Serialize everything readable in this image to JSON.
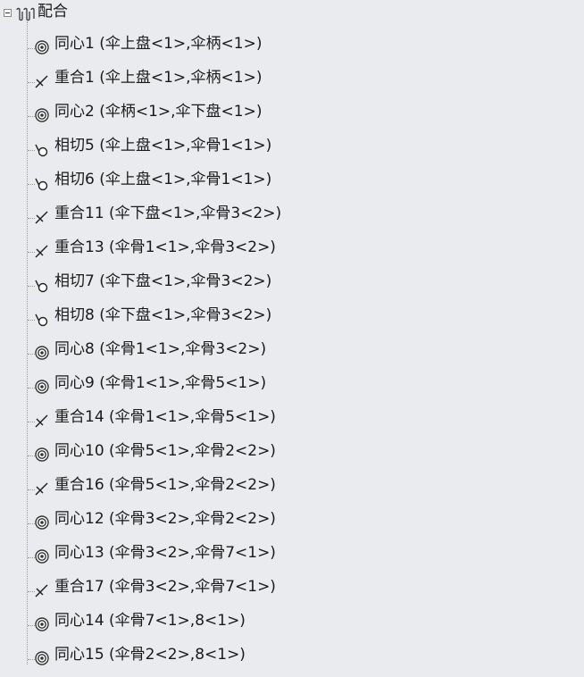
{
  "tree": {
    "root": {
      "label": "配合",
      "icon": "mate-folder-icon",
      "expanded": true
    },
    "items": [
      {
        "label": "同心1 (伞上盘<1>,伞柄<1>)",
        "icon": "concentric-mate-icon"
      },
      {
        "label": "重合1 (伞上盘<1>,伞柄<1>)",
        "icon": "coincident-mate-icon"
      },
      {
        "label": "同心2 (伞柄<1>,伞下盘<1>)",
        "icon": "concentric-mate-icon"
      },
      {
        "label": "相切5 (伞上盘<1>,伞骨1<1>)",
        "icon": "tangent-mate-icon"
      },
      {
        "label": "相切6 (伞上盘<1>,伞骨1<1>)",
        "icon": "tangent-mate-icon"
      },
      {
        "label": "重合11 (伞下盘<1>,伞骨3<2>)",
        "icon": "coincident-mate-icon"
      },
      {
        "label": "重合13 (伞骨1<1>,伞骨3<2>)",
        "icon": "coincident-mate-icon"
      },
      {
        "label": "相切7 (伞下盘<1>,伞骨3<2>)",
        "icon": "tangent-mate-icon"
      },
      {
        "label": "相切8 (伞下盘<1>,伞骨3<2>)",
        "icon": "tangent-mate-icon"
      },
      {
        "label": "同心8 (伞骨1<1>,伞骨3<2>)",
        "icon": "concentric-mate-icon"
      },
      {
        "label": "同心9 (伞骨1<1>,伞骨5<1>)",
        "icon": "concentric-mate-icon"
      },
      {
        "label": "重合14 (伞骨1<1>,伞骨5<1>)",
        "icon": "coincident-mate-icon"
      },
      {
        "label": "同心10 (伞骨5<1>,伞骨2<2>)",
        "icon": "concentric-mate-icon"
      },
      {
        "label": "重合16 (伞骨5<1>,伞骨2<2>)",
        "icon": "coincident-mate-icon"
      },
      {
        "label": "同心12 (伞骨3<2>,伞骨2<2>)",
        "icon": "concentric-mate-icon"
      },
      {
        "label": "同心13 (伞骨3<2>,伞骨7<1>)",
        "icon": "concentric-mate-icon"
      },
      {
        "label": "重合17 (伞骨3<2>,伞骨7<1>)",
        "icon": "coincident-mate-icon"
      },
      {
        "label": "同心14 (伞骨7<1>,8<1>)",
        "icon": "concentric-mate-icon"
      },
      {
        "label": "同心15 (伞骨2<2>,8<1>)",
        "icon": "concentric-mate-icon"
      }
    ]
  }
}
